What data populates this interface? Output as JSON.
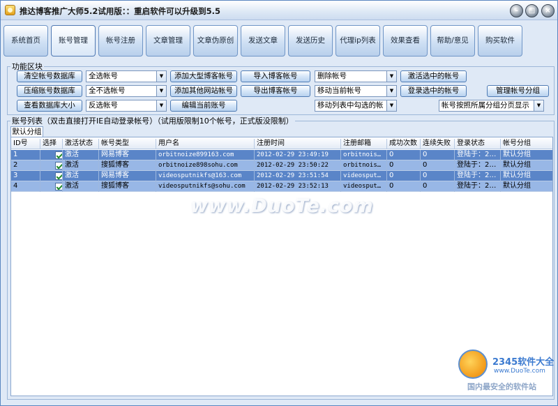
{
  "window": {
    "title": "推达博客推广大师5.2试用版：：重启软件可以升级到5.5"
  },
  "tabs": [
    {
      "label": "系统首页"
    },
    {
      "label": "账号管理"
    },
    {
      "label": "帐号注册"
    },
    {
      "label": "文章管理"
    },
    {
      "label": "文章伪原创"
    },
    {
      "label": "发送文章"
    },
    {
      "label": "发送历史"
    },
    {
      "label": "代理ip列表"
    },
    {
      "label": "效果查看"
    },
    {
      "label": "帮助/意见"
    },
    {
      "label": "购买软件"
    }
  ],
  "function_area": {
    "label": "功能区块",
    "buttons": {
      "clear_db": "清空帐号数据库",
      "compress_db": "压缩账号数据库",
      "view_db_size": "查看数据库大小",
      "add_large_blog": "添加大型博客帐号",
      "add_other_site": "添加其他网站帐号",
      "edit_current": "编辑当前账号",
      "import_blog": "导入博客帐号",
      "export_blog": "导出博客帐号",
      "activate_selected": "激活选中的帐号",
      "login_selected": "登录选中的帐号",
      "manage_groups": "管理帐号分组"
    },
    "combos": {
      "select_all": "全选帐号",
      "select_none": "全不选帐号",
      "invert": "反选帐号",
      "delete": "删除帐号",
      "move_current": "移动当前帐号",
      "move_checked": "移动列表中勾选的帐",
      "group_display": "帐号按照所属分组分页显示"
    }
  },
  "account_list": {
    "label": "账号列表（双击直接打开IE自动登录帐号）（试用版限制10个帐号，正式版没限制）",
    "subtab": "默认分组",
    "columns": [
      "ID号",
      "选择",
      "激活状态",
      "帐号类型",
      "用户名",
      "注册时间",
      "注册邮箱",
      "成功次数",
      "连续失败",
      "登录状态",
      "帐号分组"
    ],
    "rows": [
      {
        "id": "1",
        "status": "激活",
        "type": "网易博客",
        "user": "orbitnoize899163.com",
        "time": "2012-02-29 23:49:19",
        "email": "orbitnois…",
        "success": "0",
        "fail": "0",
        "login": "登陆于：2…",
        "group": "默认分组"
      },
      {
        "id": "2",
        "status": "激活",
        "type": "搜狐博客",
        "user": "orbitnoize898sohu.com",
        "time": "2012-02-29 23:50:22",
        "email": "orbitnois…",
        "success": "0",
        "fail": "0",
        "login": "登陆于：2…",
        "group": "默认分组"
      },
      {
        "id": "3",
        "status": "激活",
        "type": "网易博客",
        "user": "videosputnikfs@163.com",
        "time": "2012-02-29 23:51:54",
        "email": "videosput…",
        "success": "0",
        "fail": "0",
        "login": "登陆于：2…",
        "group": "默认分组"
      },
      {
        "id": "4",
        "status": "激活",
        "type": "搜狐博客",
        "user": "videosputnikfs@sohu.com",
        "time": "2012-02-29 23:52:13",
        "email": "videosput…",
        "success": "0",
        "fail": "0",
        "login": "登陆于：2…",
        "group": "默认分组"
      }
    ]
  },
  "watermark": {
    "text": "www.DuoTe.com",
    "brand": "2345软件大全",
    "url": "www.DuoTe.com",
    "slogan": "国内最安全的软件站"
  }
}
